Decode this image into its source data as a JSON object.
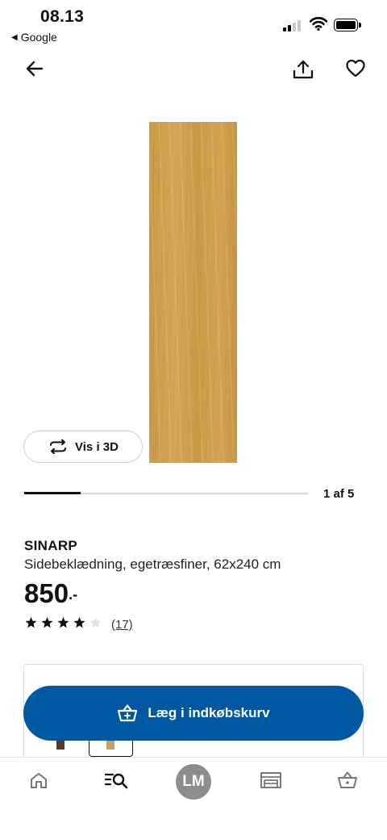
{
  "status_bar": {
    "time": "08.13",
    "back_app_label": "Google"
  },
  "product": {
    "name": "SINARP",
    "description": "Sidebeklædning, egetræsfiner, 62x240 cm",
    "price": "850",
    "price_suffix": ".-",
    "rating": 4,
    "rating_max": 5,
    "review_count": "(17)",
    "image_icon": "wood-panel-image",
    "wood_color": "#cd9f4d"
  },
  "gallery": {
    "view_3d_label": "Vis i 3D",
    "page_counter": "1 af 5",
    "progress": 0.2
  },
  "cart": {
    "add_label": "Læg i indkøbskurv",
    "button_color": "#0058a3"
  },
  "tabbar": {
    "avatar_initials": "LM",
    "items": [
      "home-icon",
      "search-list-icon",
      "avatar",
      "store-icon",
      "basket-icon"
    ]
  }
}
